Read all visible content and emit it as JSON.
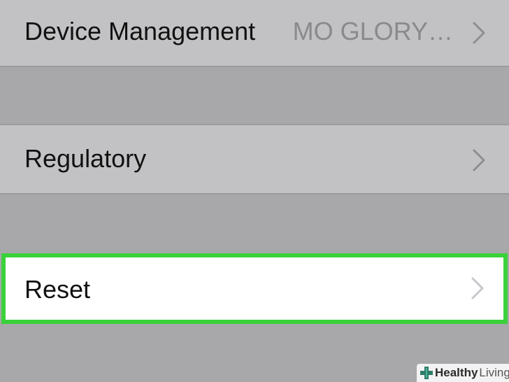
{
  "settings": {
    "device_management": {
      "label": "Device Management",
      "value": "MO GLORY…",
      "chevron_icon": "chevron-right-icon"
    },
    "regulatory": {
      "label": "Regulatory",
      "chevron_icon": "chevron-right-icon"
    },
    "reset": {
      "label": "Reset",
      "chevron_icon": "chevron-right-icon",
      "highlight_color": "#3ad13a"
    }
  },
  "watermark": {
    "brand_bold": "Healthy",
    "brand_light": "Living",
    "icon": "plus-cross-logo-icon"
  },
  "colors": {
    "background": "#a8a8ab",
    "row_background": "#c2c2c4",
    "selected_row_background": "#ffffff",
    "highlight": "#3ad13a"
  }
}
